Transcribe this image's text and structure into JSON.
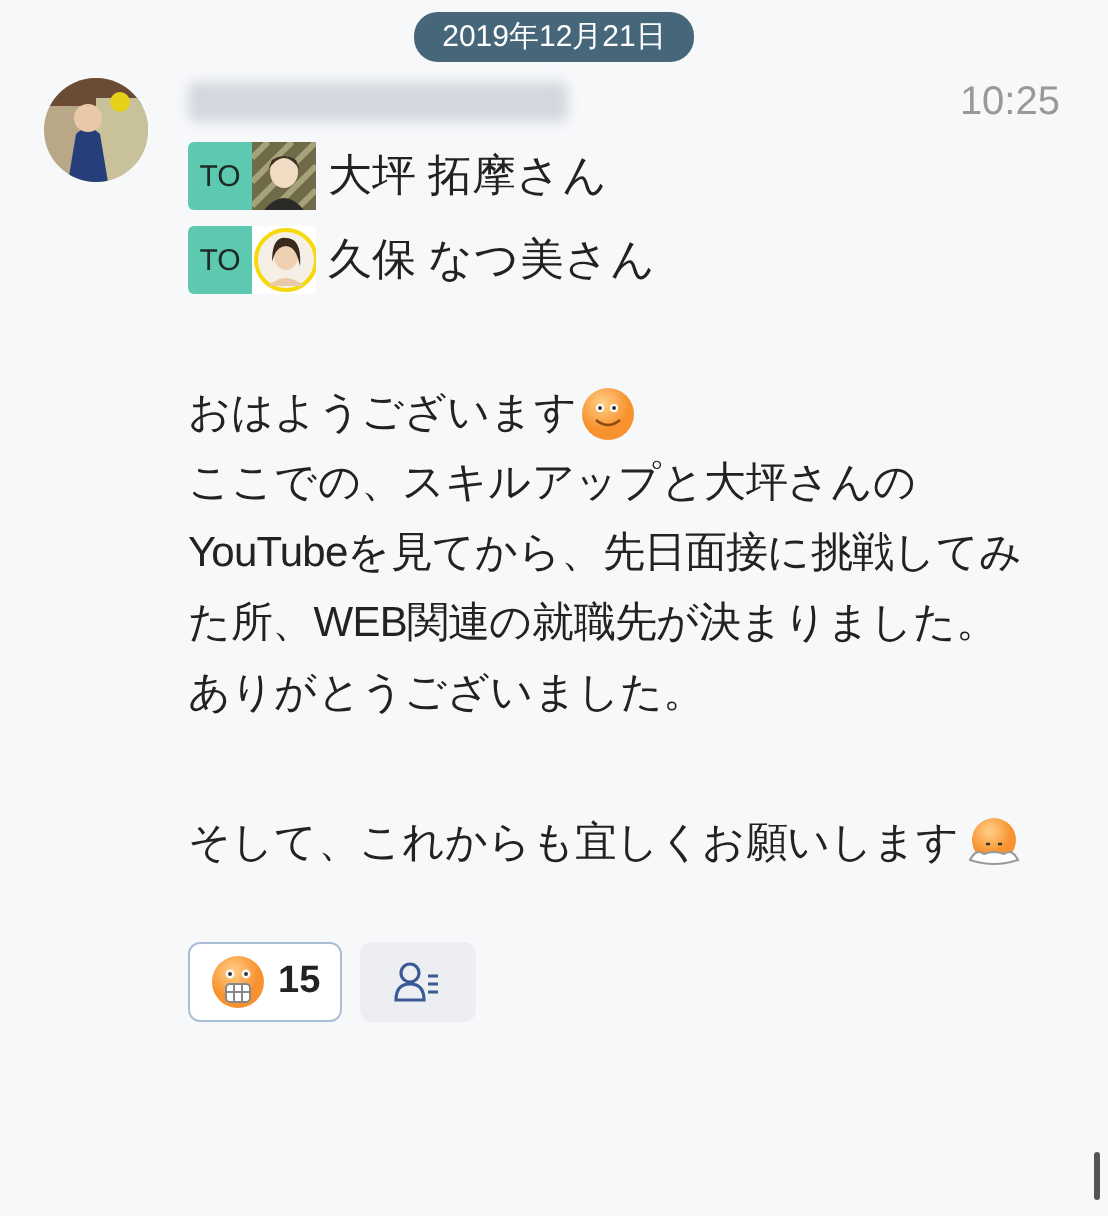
{
  "date_label": "2019年12月21日",
  "message": {
    "time": "10:25",
    "sender_blurred": true,
    "recipients": [
      {
        "tag": "TO",
        "name": "大坪 拓摩さん"
      },
      {
        "tag": "TO",
        "name": "久保 なつ美さん"
      }
    ],
    "body": [
      {
        "kind": "gap"
      },
      {
        "kind": "line",
        "text": "おはようございます",
        "emoji": {
          "kind": "smile"
        }
      },
      {
        "kind": "line",
        "text": "ここでの、スキルアップと大坪さんのYouTubeを見てから、先日面接に挑戦してみた所、WEB関連の就職先が決まりました。"
      },
      {
        "kind": "line",
        "text": "ありがとうございました。"
      },
      {
        "kind": "gap"
      },
      {
        "kind": "line",
        "text": "そして、これからも宜しくお願いします",
        "emoji": {
          "kind": "bow"
        }
      }
    ],
    "reactions": [
      {
        "emoji": {
          "kind": "grimace"
        },
        "count": "15"
      }
    ]
  }
}
